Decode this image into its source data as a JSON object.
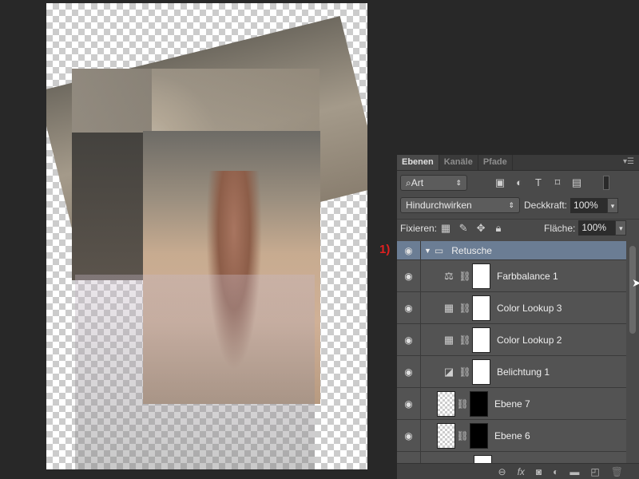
{
  "annotation": "1)",
  "panel": {
    "tabs": [
      "Ebenen",
      "Kanäle",
      "Pfade"
    ],
    "filter": {
      "value": "Art",
      "search_icon": "search-icon"
    },
    "filter_icons": [
      "image-icon",
      "adjustment-icon",
      "text-icon",
      "shape-icon",
      "smart-object-icon"
    ],
    "blend_mode": "Hindurchwirken",
    "opacity_label": "Deckkraft:",
    "opacity": "100%",
    "lock_label": "Fixieren:",
    "fill_label": "Fläche:",
    "fill": "100%",
    "layers": [
      {
        "name": "Retusche",
        "type": "group"
      },
      {
        "name": "Farbbalance 1",
        "type": "color-balance"
      },
      {
        "name": "Color Lookup 3",
        "type": "color-lookup"
      },
      {
        "name": "Color Lookup 2",
        "type": "color-lookup"
      },
      {
        "name": "Belichtung 1",
        "type": "exposure"
      },
      {
        "name": "Ebene 7",
        "type": "pixel-masked"
      },
      {
        "name": "Ebene 6",
        "type": "pixel-masked"
      }
    ],
    "footer_icons": [
      "link-icon",
      "fx-icon",
      "mask-icon",
      "adjustment-icon",
      "folder-icon",
      "new-layer-icon",
      "trash-icon"
    ]
  }
}
